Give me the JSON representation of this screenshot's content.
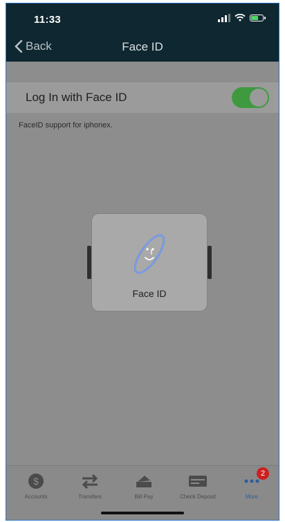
{
  "status_bar": {
    "time": "11:33"
  },
  "nav": {
    "back_label": "Back",
    "title": "Face ID"
  },
  "setting": {
    "label": "Log In with Face ID",
    "enabled": true,
    "description": "FaceID support for iphonex."
  },
  "overlay": {
    "label": "Face ID",
    "icon": "face-id-icon"
  },
  "tabbar": {
    "items": [
      {
        "label": "Accounts",
        "icon": "dollar-icon"
      },
      {
        "label": "Transfers",
        "icon": "transfer-arrows-icon"
      },
      {
        "label": "Bill Pay",
        "icon": "bill-pay-icon"
      },
      {
        "label": "Check Deposit",
        "icon": "check-deposit-icon"
      },
      {
        "label": "More",
        "icon": "more-dots-icon",
        "badge": "2",
        "active": true
      }
    ]
  },
  "colors": {
    "header_bg": "#0f2730",
    "toggle_on": "#3f9a3f",
    "active_tab": "#2c5d98",
    "badge": "#cc2020"
  }
}
